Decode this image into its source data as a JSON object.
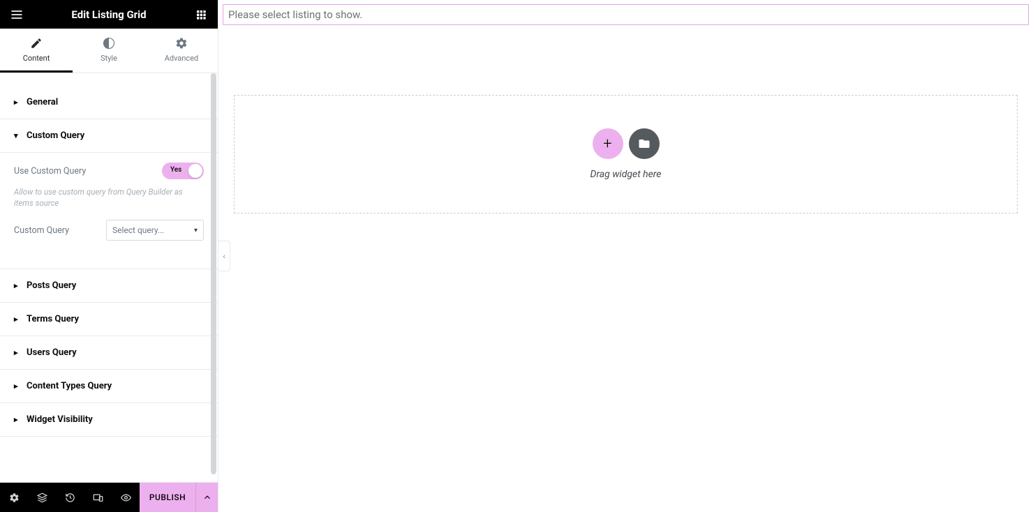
{
  "header": {
    "title": "Edit Listing Grid"
  },
  "tabs": {
    "content": "Content",
    "style": "Style",
    "advanced": "Advanced"
  },
  "sections": {
    "general": "General",
    "custom_query": {
      "title": "Custom Query",
      "use_label": "Use Custom Query",
      "toggle_value": "Yes",
      "hint": "Allow to use custom query from Query Builder as items source",
      "select_label": "Custom Query",
      "select_placeholder": "Select query..."
    },
    "posts_query": "Posts Query",
    "terms_query": "Terms Query",
    "users_query": "Users Query",
    "content_types_query": "Content Types Query",
    "widget_visibility": "Widget Visibility"
  },
  "footer": {
    "publish": "PUBLISH"
  },
  "canvas": {
    "notice": "Please select listing to show.",
    "drag_hint": "Drag widget here"
  }
}
